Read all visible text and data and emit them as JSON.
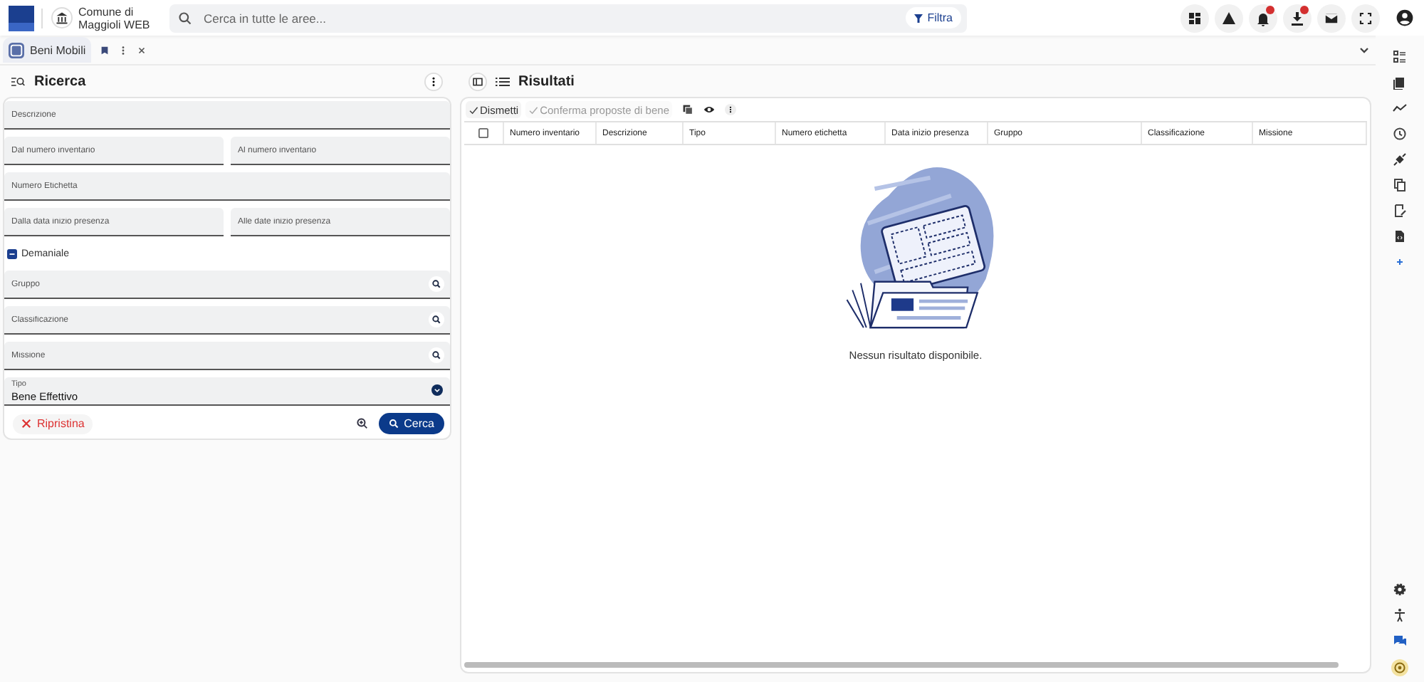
{
  "header": {
    "org_name": [
      "Comune di",
      "Maggioli WEB"
    ],
    "search": {
      "placeholder": "Cerca in tutte le aree..."
    },
    "filter_button": "Filtra"
  },
  "tabs": [
    {
      "label": "Beni Mobili",
      "selected": true
    }
  ],
  "search_panel": {
    "title": "Ricerca",
    "rows": [
      {
        "kind": "fields",
        "fields": [
          {
            "kind": "text",
            "placeholder": "Descrizione"
          }
        ]
      },
      {
        "kind": "fields",
        "fields": [
          {
            "kind": "text",
            "placeholder": "Dal numero inventario"
          },
          {
            "kind": "text",
            "placeholder": "Al numero inventario"
          }
        ]
      },
      {
        "kind": "fields",
        "fields": [
          {
            "kind": "text",
            "placeholder": "Numero Etichetta"
          }
        ]
      },
      {
        "kind": "fields",
        "fields": [
          {
            "kind": "text",
            "placeholder": "Dalla data inizio presenza"
          },
          {
            "kind": "text",
            "placeholder": "Alle date inizio presenza"
          }
        ]
      },
      {
        "kind": "checkbox",
        "label": "Demaniale",
        "indeterminate": true
      },
      {
        "kind": "fields",
        "fields": [
          {
            "kind": "lookup",
            "placeholder": "Gruppo"
          }
        ]
      },
      {
        "kind": "fields",
        "fields": [
          {
            "kind": "lookup",
            "placeholder": "Classificazione"
          }
        ]
      },
      {
        "kind": "fields",
        "fields": [
          {
            "kind": "lookup",
            "placeholder": "Missione"
          }
        ]
      },
      {
        "kind": "fields",
        "fields": [
          {
            "kind": "select",
            "label": "Tipo",
            "value": "Bene Effettivo"
          }
        ]
      }
    ],
    "reset_button": "Ripristina",
    "submit_button": "Cerca"
  },
  "results": {
    "title": "Risultati",
    "toolbar": [
      {
        "label": "Dismetti",
        "disabled": false
      },
      {
        "label": "Conferma proposte di bene",
        "disabled": true
      }
    ],
    "select_all_checked": false,
    "columns": [
      "Numero inventario",
      "Descrizione",
      "Tipo",
      "Numero etichetta",
      "Data inizio presenza",
      "Gruppo",
      "Classificazione",
      "Missione"
    ],
    "empty_message": "Nessun risultato disponibile."
  }
}
